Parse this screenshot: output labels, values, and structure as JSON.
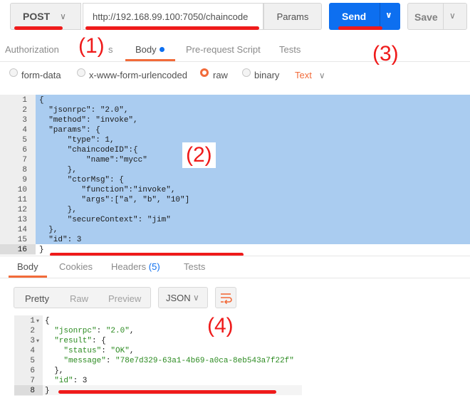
{
  "request": {
    "method": "POST",
    "url": "http://192.168.99.100:7050/chaincode",
    "params_label": "Params",
    "send_label": "Send",
    "save_label": "Save"
  },
  "request_tabs": [
    {
      "label": "Authorization"
    },
    {
      "label": "s"
    },
    {
      "label": "Body"
    },
    {
      "label": "Pre-request Script"
    },
    {
      "label": "Tests"
    }
  ],
  "body_types": [
    {
      "label": "form-data",
      "selected": false
    },
    {
      "label": "x-www-form-urlencoded",
      "selected": false
    },
    {
      "label": "raw",
      "selected": true
    },
    {
      "label": "binary",
      "selected": false
    }
  ],
  "raw_format": "Text",
  "request_body_lines": [
    "{",
    "  \"jsonrpc\": \"2.0\",",
    "  \"method\": \"invoke\",",
    "  \"params\": {",
    "      \"type\": 1,",
    "      \"chaincodeID\":{",
    "          \"name\":\"mycc\"",
    "      },",
    "      \"ctorMsg\": {",
    "         \"function\":\"invoke\",",
    "         \"args\":[\"a\", \"b\", \"10\"]",
    "      },",
    "      \"secureContext\": \"jim\"",
    "  },",
    "  \"id\": 3",
    "}"
  ],
  "response_tabs": [
    {
      "label": "Body"
    },
    {
      "label": "Cookies"
    },
    {
      "label": "Headers"
    },
    {
      "label": "Tests"
    }
  ],
  "headers_count": "(5)",
  "view_modes": [
    "Pretty",
    "Raw",
    "Preview"
  ],
  "response_format": "JSON",
  "response_body_lines": [
    "{",
    "  \"jsonrpc\": \"2.0\",",
    "  \"result\": {",
    "    \"status\": \"OK\",",
    "    \"message\": \"78e7d329-63a1-4b69-a0ca-8eb543a7f22f\"",
    "  },",
    "  \"id\": 3",
    "}"
  ],
  "annotations": [
    "(1)",
    "(2)",
    "(3)",
    "(4)"
  ],
  "colors": {
    "accent": "#f26b3a",
    "send": "#0d6ff0",
    "annotation": "#ef1b1b",
    "selection": "#aaccf0"
  }
}
